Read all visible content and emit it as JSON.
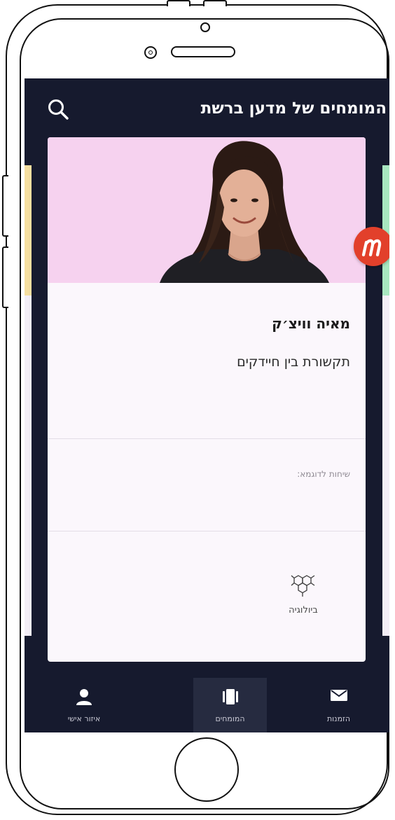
{
  "app": {
    "title": "המומחים של מדען ברשת"
  },
  "expert": {
    "name": "מאיה וויצ׳ק",
    "topic": "תקשורת בין חיידקים",
    "examples_label": "שיחות לדוגמא:",
    "subject": {
      "label": "ביולוגיה",
      "icon": "molecule-icon"
    }
  },
  "bottom_nav": {
    "items": [
      {
        "label": "הזמנות",
        "icon": "envelope-icon",
        "active": false
      },
      {
        "label": "המומחים",
        "icon": "cards-icon",
        "active": true
      },
      {
        "label": "איזור אישי",
        "icon": "user-icon",
        "active": false
      }
    ]
  },
  "colors": {
    "screen_bg": "#161a2e",
    "photo_bg": "#f6d2ef",
    "card_bg": "#fbf7fc",
    "badge": "#e2402b",
    "peek_left": "#f5dea0",
    "peek_right": "#a8e7c0"
  }
}
